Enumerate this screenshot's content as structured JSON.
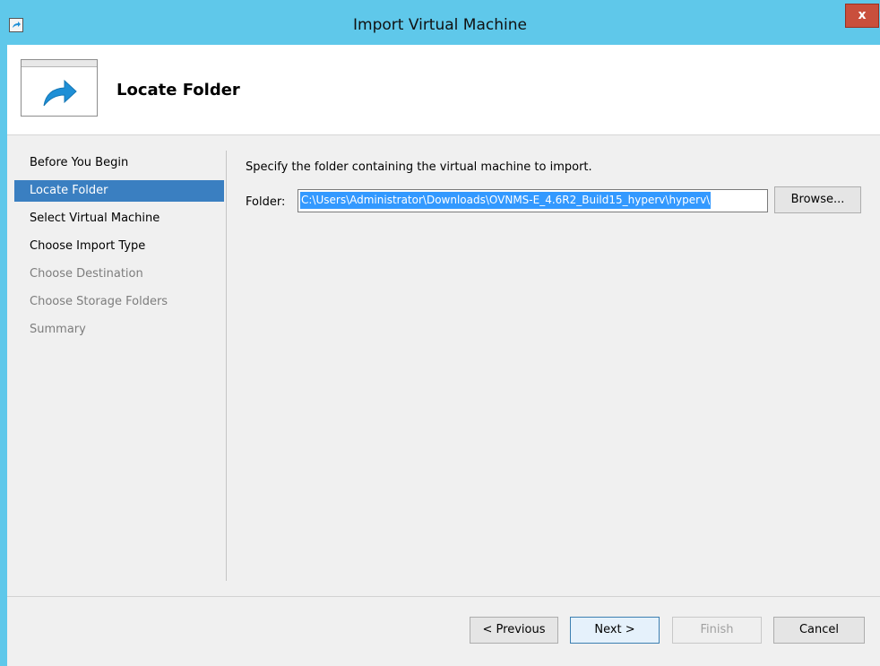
{
  "window": {
    "title": "Import Virtual Machine",
    "close_label": "x"
  },
  "header": {
    "title": "Locate Folder",
    "icon": "forward-arrow-icon"
  },
  "nav": {
    "items": [
      {
        "label": "Before You Begin",
        "state": "normal"
      },
      {
        "label": "Locate Folder",
        "state": "selected"
      },
      {
        "label": "Select Virtual Machine",
        "state": "normal"
      },
      {
        "label": "Choose Import Type",
        "state": "normal"
      },
      {
        "label": "Choose Destination",
        "state": "disabled"
      },
      {
        "label": "Choose Storage Folders",
        "state": "disabled"
      },
      {
        "label": "Summary",
        "state": "disabled"
      }
    ]
  },
  "main": {
    "instruction": "Specify the folder containing the virtual machine to import.",
    "folder_label": "Folder:",
    "folder_value": "C:\\Users\\Administrator\\Downloads\\OVNMS-E_4.6R2_Build15_hyperv\\hyperv\\",
    "browse_label": "Browse..."
  },
  "footer": {
    "previous_label": "< Previous",
    "next_label": "Next >",
    "finish_label": "Finish",
    "cancel_label": "Cancel"
  },
  "colors": {
    "titlebar": "#5fc8ea",
    "selection": "#3a7fc1",
    "text_selection": "#3399ff",
    "close": "#c94f3c",
    "icon_arrow": "#1e8fd6"
  }
}
